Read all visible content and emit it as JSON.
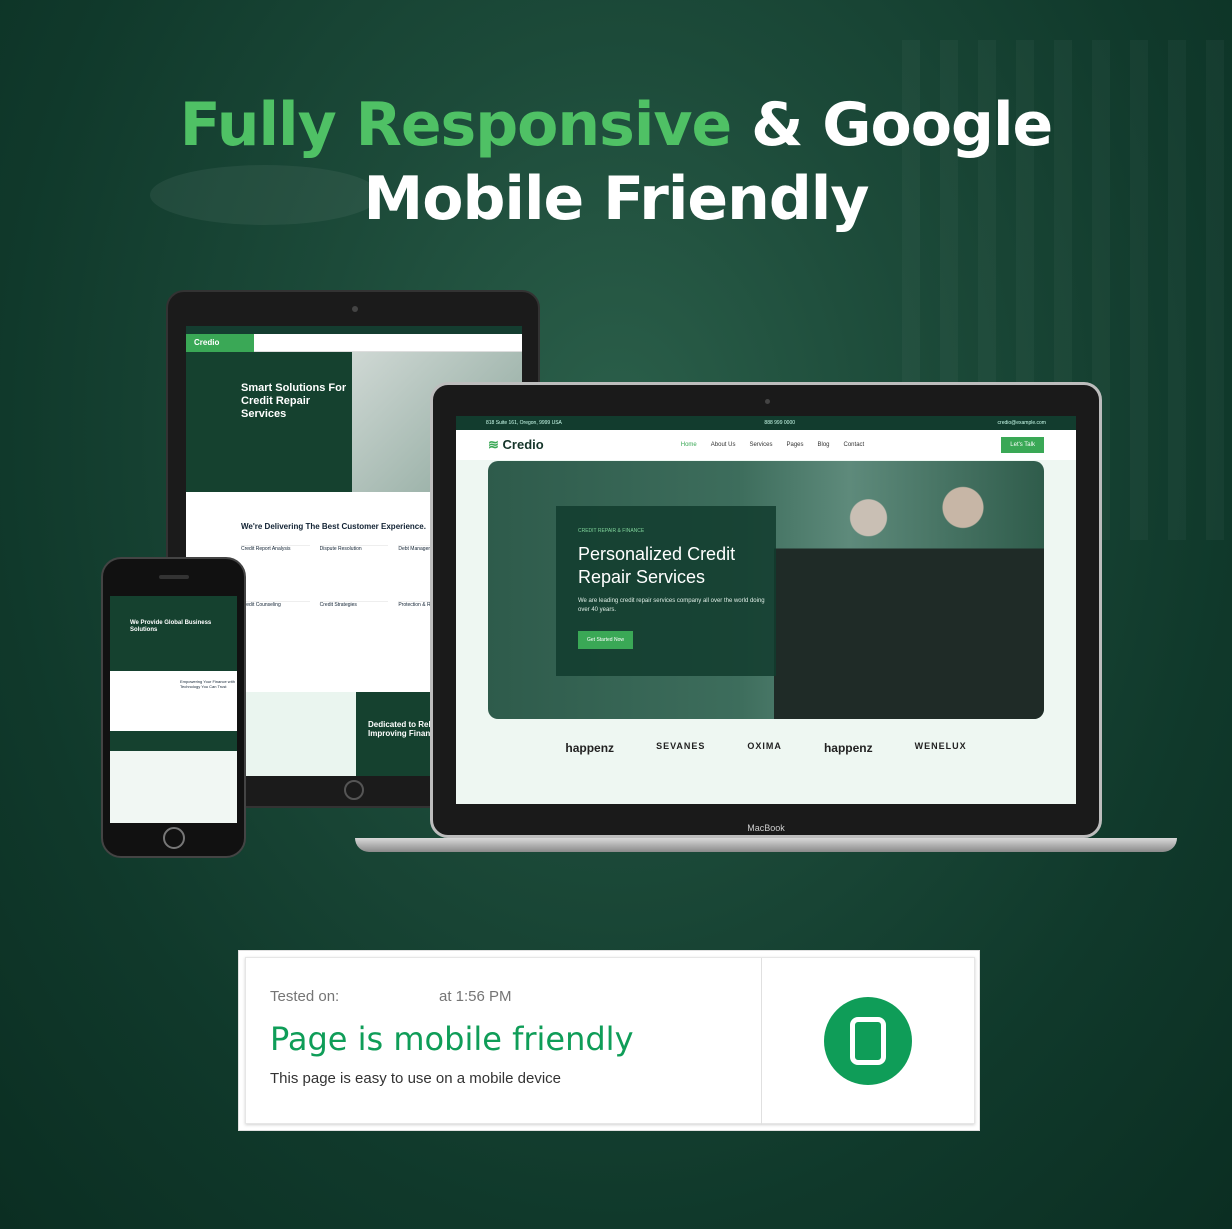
{
  "headline": {
    "green": "Fully Responsive",
    "white1": " & Google",
    "line2": "Mobile Friendly"
  },
  "tablet": {
    "logo": "Credio",
    "hero_title": "Smart Solutions For Credit Repair Services",
    "section_title": "We're Delivering The Best Customer Experience.",
    "grid": [
      "Credit Report Analysis",
      "Dispute Resolution",
      "Debt Management",
      "Credit Counseling",
      "Credit Strategies",
      "Protection & Restoration"
    ],
    "footer_title": "Dedicated to Rebuilding Your Credit & Improving Financial Health."
  },
  "laptop": {
    "topbar_address": "818 Suite 161, Oregon, 9999 USA",
    "topbar_phone": "888 999 0000",
    "topbar_email": "credio@example.com",
    "logo": "Credio",
    "menu": [
      "Home",
      "About Us",
      "Services",
      "Pages",
      "Blog",
      "Contact"
    ],
    "cta_label": "Let's Talk",
    "hero_kicker": "CREDIT REPAIR & FINANCE",
    "hero_title": "Personalized Credit Repair Services",
    "hero_text": "We are leading credit repair services company all over the world doing over 40 years.",
    "hero_button": "Get Started Now",
    "logos": [
      "happenz",
      "SEVANES",
      "OXIMA",
      "happenz",
      "WENELUX"
    ],
    "brand": "MacBook"
  },
  "phone": {
    "hero_title": "We Provide Global Business Solutions",
    "section_title": "Empowering Your Finance with Technology You Can Trust"
  },
  "result": {
    "tested_label": "Tested on:",
    "tested_time": "at 1:56 PM",
    "title": "Page is mobile friendly",
    "subtitle": "This page is easy to use on a mobile device",
    "accent": "#0f9d58"
  }
}
